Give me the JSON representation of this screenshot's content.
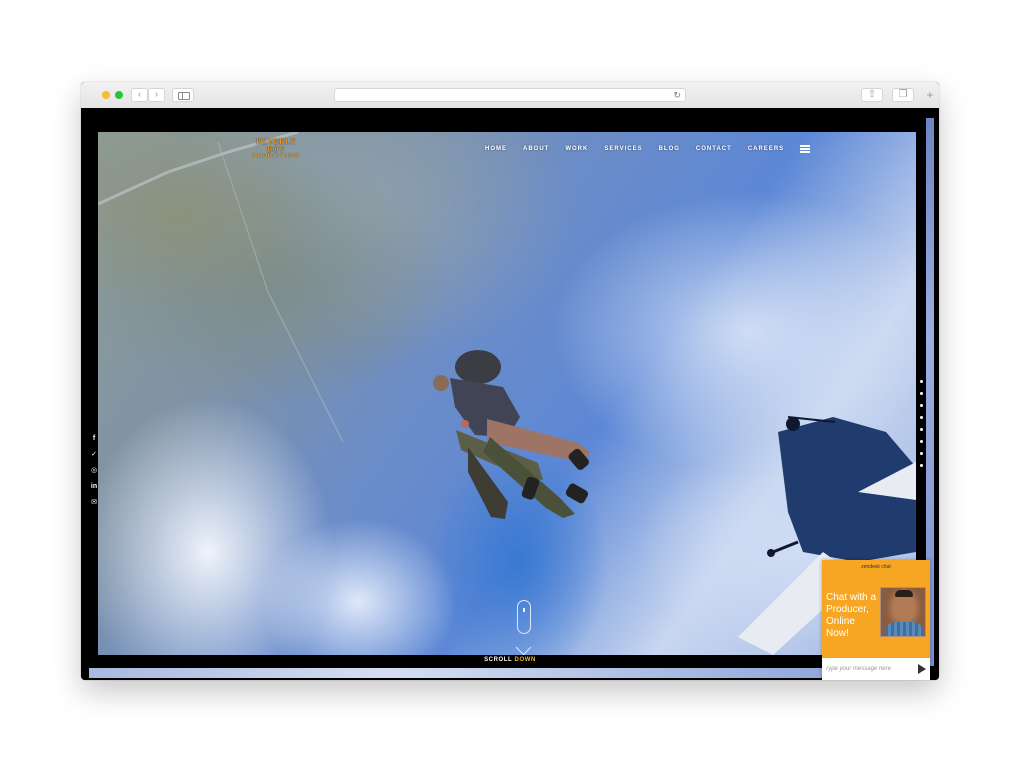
{
  "site": {
    "logo": {
      "main": "BEVERLY BOY",
      "sub": "PRODUCTIONS"
    },
    "nav": [
      "HOME",
      "ABOUT",
      "WORK",
      "SERVICES",
      "BLOG",
      "CONTACT",
      "CAREERS"
    ],
    "social_icons": [
      "facebook-icon",
      "twitter-icon",
      "instagram-icon",
      "linkedin-icon",
      "email-icon"
    ],
    "section_dots": 8,
    "scroll": {
      "word1": "SCROLL",
      "word2": "DOWN",
      "accent_color": "#f3b82c"
    }
  },
  "chat": {
    "header": "zendesk chat",
    "message": "Chat with a Producer, Online Now!",
    "placeholder": "Type your message here",
    "color": "#f6a623"
  }
}
